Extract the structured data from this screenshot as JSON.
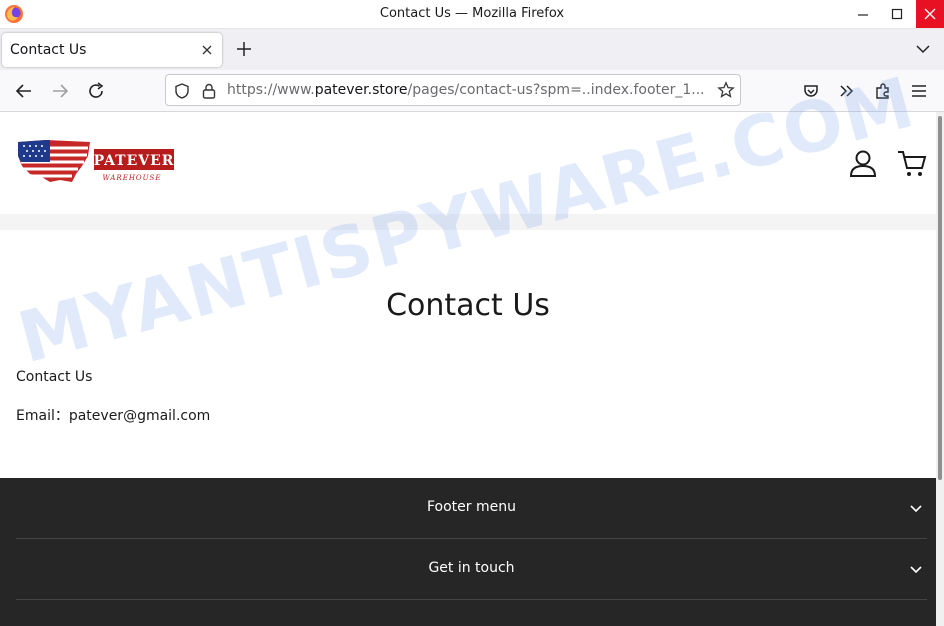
{
  "window": {
    "title": "Contact Us — Mozilla Firefox"
  },
  "tabs": [
    {
      "label": "Contact Us"
    }
  ],
  "urlbar": {
    "prefix": "https://www.",
    "host": "patever.store",
    "path": "/pages/contact-us?spm=..index.footer_1..."
  },
  "icons": {
    "back": "arrow-left-icon",
    "forward": "arrow-right-icon",
    "reload": "reload-icon",
    "shield": "shield-icon",
    "lock": "lock-icon",
    "bookmark": "star-icon",
    "pocket": "pocket-icon",
    "overflow": "double-chevron-icon",
    "extensions": "puzzle-icon",
    "menu": "hamburger-icon"
  },
  "store": {
    "logo_text": "PATEVER",
    "logo_subtext": "WAREHOUSE"
  },
  "page": {
    "title": "Contact Us",
    "content_heading": "Contact Us",
    "email_line": "Email：patever@gmail.com"
  },
  "footer": {
    "rows": [
      {
        "label": "Footer menu"
      },
      {
        "label": "Get in touch"
      }
    ]
  },
  "watermark": "MYANTISPYWARE.COM",
  "colors": {
    "close_button": "#e81123",
    "footer_bg": "#262626",
    "logo_red": "#b71c1c",
    "flag_blue": "#1f3a8a"
  }
}
